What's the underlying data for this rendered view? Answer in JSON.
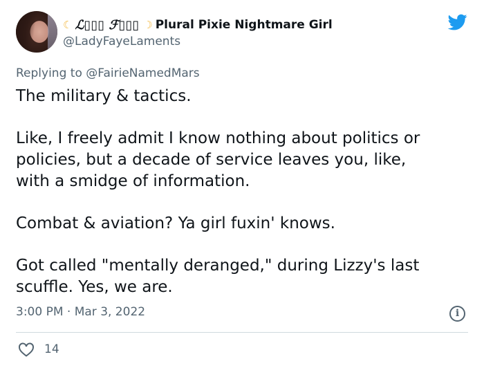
{
  "author": {
    "display_name_prefix": "ℒ▯▯▯ ℱ▯▯▯",
    "display_name_main": "Plural Pixie Nightmare Girl",
    "handle": "@LadyFayeLaments"
  },
  "reply": {
    "label": "Replying to",
    "mention": "@FairieNamedMars"
  },
  "tweet": {
    "paragraphs": [
      "The military & tactics.",
      "Like, I freely admit I know nothing about politics or\npolicies, but a decade of service leaves you, like,\nwith a smidge of information.",
      "Combat & aviation? Ya girl fuxin' knows.",
      "Got called \"mentally deranged,\" during Lizzy's last\nscuffle. Yes, we are."
    ],
    "timestamp": "3:00 PM · Mar 3, 2022",
    "likes": "14"
  },
  "icons": {
    "moon_1": "crescent-moon-icon",
    "moon_2": "crescent-moon-icon",
    "bird": "twitter-bird-icon",
    "info": "info-icon",
    "like": "heart-icon"
  },
  "colors": {
    "brand": "#1d9bf0",
    "secondary_text": "#536471",
    "divider": "#cfd9de"
  }
}
